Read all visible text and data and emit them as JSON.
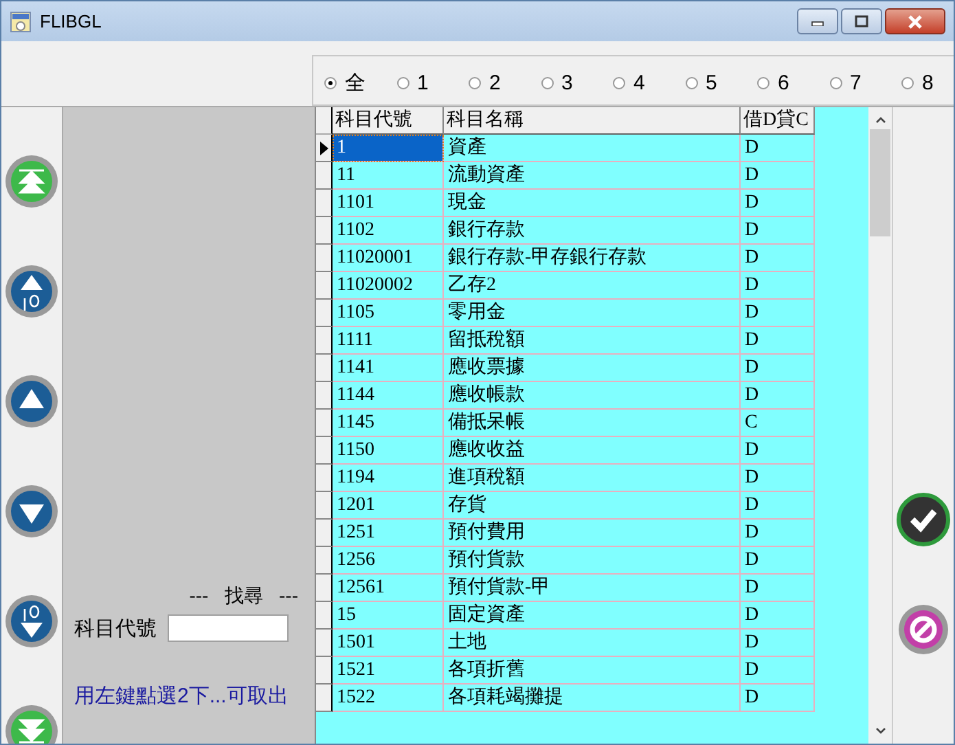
{
  "window": {
    "title": "FLIBGL"
  },
  "filter_options": [
    {
      "label": "全",
      "selected": true
    },
    {
      "label": "1",
      "selected": false
    },
    {
      "label": "2",
      "selected": false
    },
    {
      "label": "3",
      "selected": false
    },
    {
      "label": "4",
      "selected": false
    },
    {
      "label": "5",
      "selected": false
    },
    {
      "label": "6",
      "selected": false
    },
    {
      "label": "7",
      "selected": false
    },
    {
      "label": "8",
      "selected": false
    }
  ],
  "search": {
    "heading": "---   找尋   ---",
    "label": "科目代號",
    "hint": "用左鍵點選2下...可取出"
  },
  "table": {
    "columns": [
      "科目代號",
      "科目名稱",
      "借D貸C"
    ],
    "rows": [
      {
        "cells": [
          "1",
          "資產",
          "D"
        ],
        "selected": true
      },
      {
        "cells": [
          "11",
          "流動資產",
          "D"
        ],
        "selected": false
      },
      {
        "cells": [
          "1101",
          "現金",
          "D"
        ],
        "selected": false
      },
      {
        "cells": [
          "1102",
          "銀行存款",
          "D"
        ],
        "selected": false
      },
      {
        "cells": [
          "11020001",
          "銀行存款-甲存銀行存款",
          "D"
        ],
        "selected": false
      },
      {
        "cells": [
          "11020002",
          "乙存2",
          "D"
        ],
        "selected": false
      },
      {
        "cells": [
          "1105",
          "零用金",
          "D"
        ],
        "selected": false
      },
      {
        "cells": [
          "1111",
          "留抵稅額",
          "D"
        ],
        "selected": false
      },
      {
        "cells": [
          "1141",
          "應收票據",
          "D"
        ],
        "selected": false
      },
      {
        "cells": [
          "1144",
          "應收帳款",
          "D"
        ],
        "selected": false
      },
      {
        "cells": [
          "1145",
          "備抵呆帳",
          "C"
        ],
        "selected": false
      },
      {
        "cells": [
          "1150",
          "應收收益",
          "D"
        ],
        "selected": false
      },
      {
        "cells": [
          "1194",
          "進項稅額",
          "D"
        ],
        "selected": false
      },
      {
        "cells": [
          "1201",
          "存貨",
          "D"
        ],
        "selected": false
      },
      {
        "cells": [
          "1251",
          "預付費用",
          "D"
        ],
        "selected": false
      },
      {
        "cells": [
          "1256",
          "預付貨款",
          "D"
        ],
        "selected": false
      },
      {
        "cells": [
          "12561",
          "預付貨款-甲",
          "D"
        ],
        "selected": false
      },
      {
        "cells": [
          "15",
          "固定資產",
          "D"
        ],
        "selected": false
      },
      {
        "cells": [
          "1501",
          "土地",
          "D"
        ],
        "selected": false
      },
      {
        "cells": [
          "1521",
          "各項折舊",
          "D"
        ],
        "selected": false
      },
      {
        "cells": [
          "1522",
          "各項耗竭攤提",
          "D"
        ],
        "selected": false
      }
    ]
  }
}
